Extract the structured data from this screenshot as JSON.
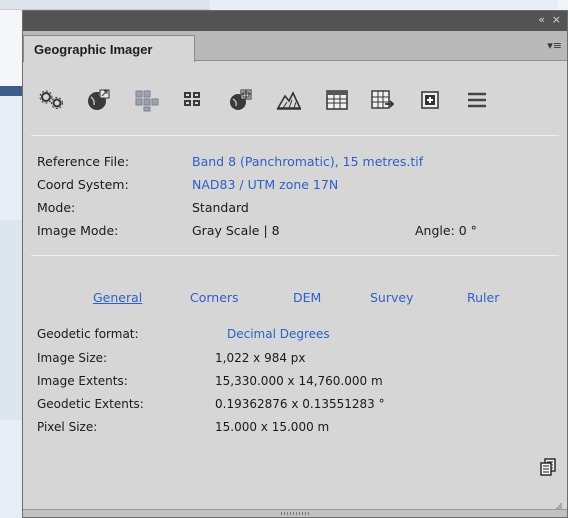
{
  "window": {
    "collapse_glyph": "«",
    "close_glyph": "×",
    "tab_title": "Geographic Imager",
    "panel_menu_glyph": "▾≡"
  },
  "toolbar": {
    "icons": [
      "settings-gears-icon",
      "globe-export-icon",
      "tiles-icon",
      "grid-icon",
      "georeference-icon",
      "terrain-icon",
      "table-icon",
      "grid-export-icon",
      "add-box-icon",
      "menu-icon"
    ]
  },
  "info": {
    "reference_file_label": "Reference File:",
    "reference_file_value": "Band 8 (Panchromatic), 15 metres.tif",
    "coord_system_label": "Coord System:",
    "coord_system_value": "NAD83 / UTM zone 17N",
    "mode_label": "Mode:",
    "mode_value": "Standard",
    "image_mode_label": "Image Mode:",
    "image_mode_value": "Gray Scale | 8",
    "angle_text": "Angle: 0 °"
  },
  "tabs": {
    "general": "General",
    "corners": "Corners",
    "dem": "DEM",
    "survey": "Survey",
    "ruler": "Ruler"
  },
  "general": {
    "geodetic_format_label": "Geodetic format:",
    "geodetic_format_value": "Decimal Degrees",
    "image_size_label": "Image Size:",
    "image_size_value": "1,022 x 984 px",
    "image_extents_label": "Image Extents:",
    "image_extents_value": "15,330.000 x 14,760.000 m",
    "geodetic_extents_label": "Geodetic Extents:",
    "geodetic_extents_value": "0.19362876 x 0.13551283 °",
    "pixel_size_label": "Pixel Size:",
    "pixel_size_value": "15.000 x 15.000 m"
  },
  "colors": {
    "panel_bg": "#d6d6d6",
    "titlebar": "#535353",
    "link": "#2d5fc9"
  }
}
